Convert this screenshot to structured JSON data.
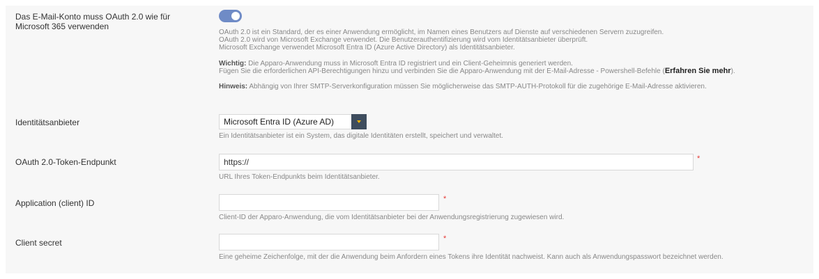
{
  "oauth": {
    "label_line1": "Das E-Mail-Konto muss OAuth 2.0 wie für",
    "label_line2": "Microsoft 365 verwenden",
    "toggle_on": true,
    "desc1": "OAuth 2.0 ist ein Standard, der es einer Anwendung ermöglicht, im Namen eines Benutzers auf Dienste auf verschiedenen Servern zuzugreifen.",
    "desc2": "OAuth 2.0 wird von Microsoft Exchange verwendet. Die Benutzerauthentifizierung wird vom Identitätsanbieter überprüft.",
    "desc3": "Microsoft Exchange verwendet Microsoft Entra ID (Azure Active Directory) als Identitätsanbieter.",
    "important_label": "Wichtig:",
    "important_text": " Die Apparo-Anwendung muss in Microsoft Entra ID registriert und ein Client-Geheimnis generiert werden.",
    "important_text2_pre": "Fügen Sie die erforderlichen API-Berechtigungen hinzu und verbinden Sie die Apparo-Anwendung mit der E-Mail-Adresse - Powershell-Befehle (",
    "learn_more": "Erfahren Sie mehr",
    "important_text2_post": ").",
    "note_label": "Hinweis:",
    "note_text": " Abhängig von Ihrer SMTP-Serverkonfiguration müssen Sie möglicherweise das SMTP-AUTH-Protokoll für die zugehörige E-Mail-Adresse aktivieren."
  },
  "identity_provider": {
    "label": "Identitätsanbieter",
    "selected": "Microsoft Entra ID (Azure AD)",
    "help": "Ein Identitätsanbieter ist ein System, das digitale Identitäten erstellt, speichert und verwaltet."
  },
  "token_endpoint": {
    "label": "OAuth 2.0-Token-Endpunkt",
    "value": "https://",
    "required_mark": "*",
    "help": "URL Ihres Token-Endpunkts beim Identitätsanbieter."
  },
  "client_id": {
    "label": "Application (client) ID",
    "value": "",
    "required_mark": "*",
    "help": "Client-ID der Apparo-Anwendung, die vom Identitätsanbieter bei der Anwendungsregistrierung zugewiesen wird."
  },
  "client_secret": {
    "label": "Client secret",
    "value": "",
    "required_mark": "*",
    "help": "Eine geheime Zeichenfolge, mit der die Anwendung beim Anfordern eines Tokens ihre Identität nachweist. Kann auch als Anwendungspasswort bezeichnet werden."
  },
  "colors": {
    "toggle_on": "#6f8bc6",
    "required": "#e53935",
    "select_arrow_bg": "#3e4d5e",
    "select_arrow": "#f0b300"
  }
}
